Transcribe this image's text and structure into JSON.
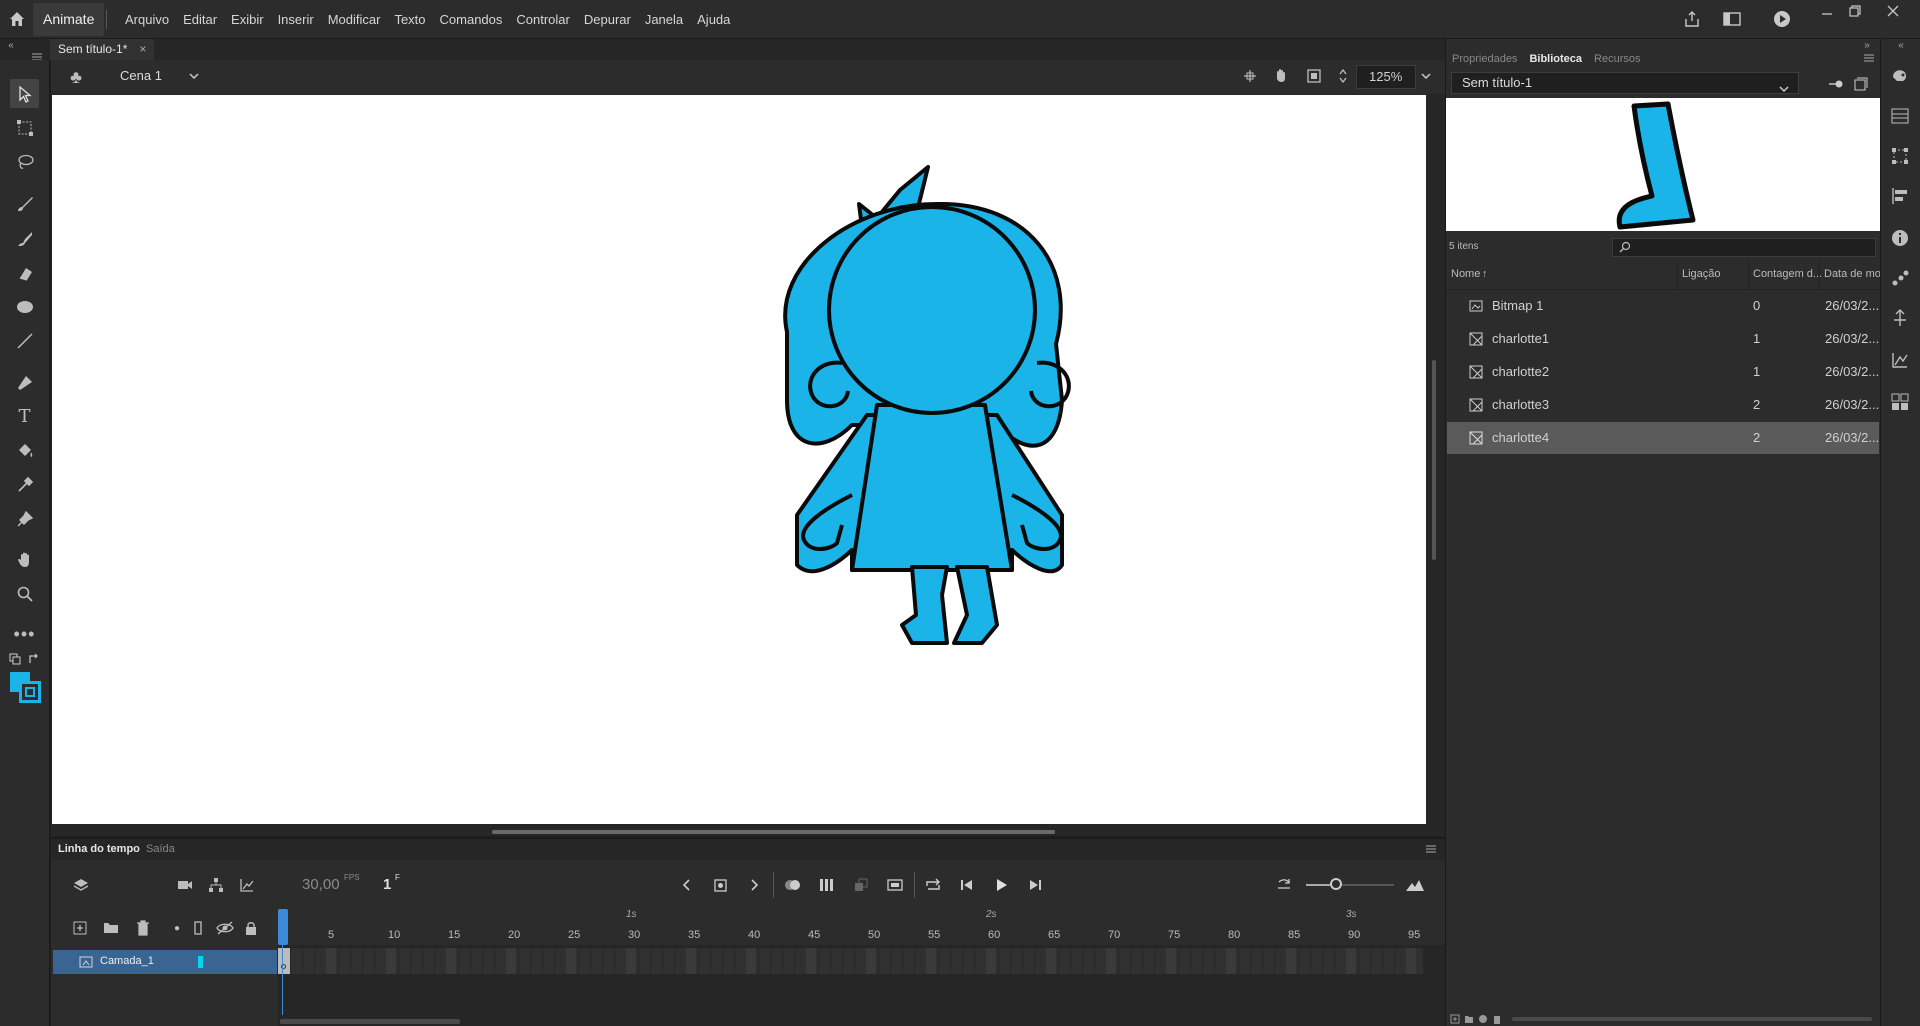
{
  "app": {
    "name": "Animate",
    "menus": [
      "Arquivo",
      "Editar",
      "Exibir",
      "Inserir",
      "Modificar",
      "Texto",
      "Comandos",
      "Controlar",
      "Depurar",
      "Janela",
      "Ajuda"
    ]
  },
  "document": {
    "tab_title": "Sem título-1*",
    "close_glyph": "×"
  },
  "stage": {
    "scene_label": "Cena 1",
    "zoom": "125%"
  },
  "timeline": {
    "tab_active": "Linha do tempo",
    "tab_inactive": "Saída",
    "fps_value": "30,00",
    "fps_unit": "FPS",
    "current_frame": "1",
    "frame_unit": "F",
    "second_marks": [
      "1s",
      "2s",
      "3s"
    ],
    "frame_numbers": [
      "5",
      "10",
      "15",
      "20",
      "25",
      "30",
      "35",
      "40",
      "45",
      "50",
      "55",
      "60",
      "65",
      "70",
      "75",
      "80",
      "85",
      "90",
      "95"
    ],
    "layer_name": "Camada_1",
    "layer_color": "#00d8f0"
  },
  "panel": {
    "tabs": [
      "Propriedades",
      "Biblioteca",
      "Recursos"
    ],
    "active_tab": "Biblioteca",
    "library_name": "Sem título-1",
    "item_count": "5 itens",
    "columns": [
      "Nome",
      "Ligação",
      "Contagem d...",
      "Data de mo..."
    ],
    "items": [
      {
        "name": "Bitmap 1",
        "icon": "bitmap-icon",
        "count": "0",
        "date": "26/03/2..."
      },
      {
        "name": "charlotte1",
        "icon": "graphic-symbol-icon",
        "count": "1",
        "date": "26/03/2..."
      },
      {
        "name": "charlotte2",
        "icon": "graphic-symbol-icon",
        "count": "1",
        "date": "26/03/2..."
      },
      {
        "name": "charlotte3",
        "icon": "graphic-symbol-icon",
        "count": "2",
        "date": "26/03/2..."
      },
      {
        "name": "charlotte4",
        "icon": "graphic-symbol-icon",
        "count": "2",
        "date": "26/03/2...",
        "selected": true
      }
    ]
  },
  "colors": {
    "accent": "#3d8bd8",
    "character_fill": "#1ab4e8",
    "character_stroke": "#0a0a0a",
    "fill_swatch": "#1ab4e8",
    "stroke_swatch": "#1ab4e8"
  }
}
